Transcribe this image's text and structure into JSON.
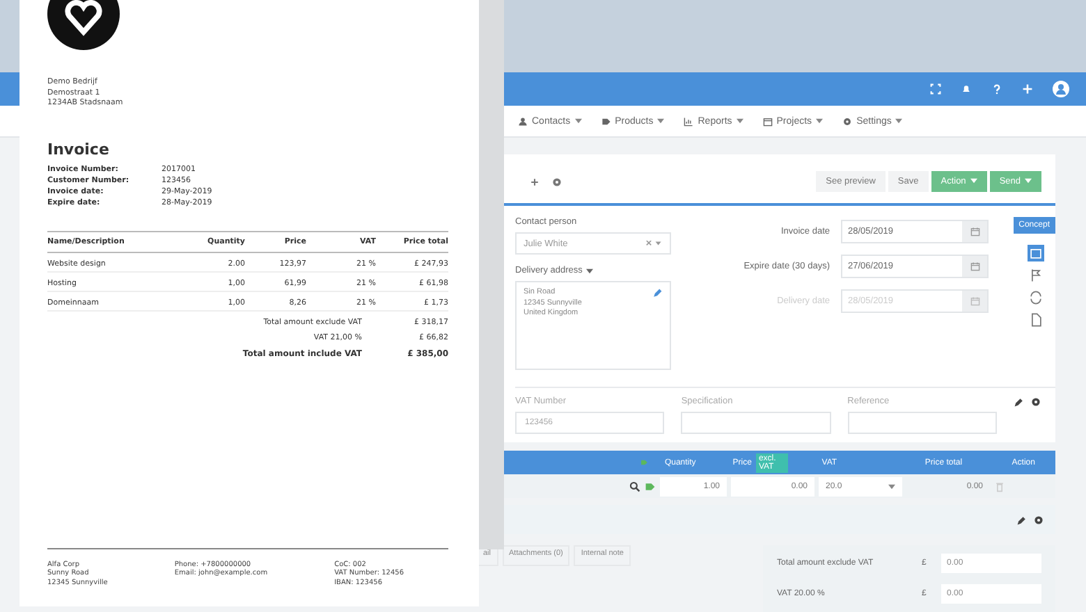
{
  "document": {
    "sender_address": [
      "Demo Bedrijf",
      "Demostraat 1",
      "1234AB Stadsnaam"
    ],
    "title": "Invoice",
    "meta": [
      {
        "label": "Invoice Number:",
        "value": "2017001"
      },
      {
        "label": "Customer Number:",
        "value": "123456"
      },
      {
        "label": "Invoice date:",
        "value": "29-May-2019"
      },
      {
        "label": "Expire date:",
        "value": "28-May-2019"
      }
    ],
    "columns": [
      "Name/Description",
      "Quantity",
      "Price",
      "VAT",
      "Price total"
    ],
    "rows": [
      {
        "name": "Website design",
        "quantity": "2.00",
        "price": "123,97",
        "vat": "21 %",
        "total": "£ 247,93"
      },
      {
        "name": "Hosting",
        "quantity": "1,00",
        "price": "61,99",
        "vat": "21 %",
        "total": "£ 61,98"
      },
      {
        "name": "Domeinnaam",
        "quantity": "1,00",
        "price": "8,26",
        "vat": "21 %",
        "total": "£ 1,73"
      }
    ],
    "totals": [
      {
        "label": "Total amount exclude VAT",
        "value": "£ 318,17",
        "bold": false
      },
      {
        "label": "VAT 21,00 %",
        "value": "£ 66,82",
        "bold": false
      },
      {
        "label": "Total amount include VAT",
        "value": "£ 385,00",
        "bold": true
      }
    ],
    "footer": [
      [
        "Alfa Corp",
        "Sunny Road",
        "12345 Sunnyville"
      ],
      [
        "Phone: +7800000000",
        "Email: john@example.com"
      ],
      [
        "CoC: 002",
        "VAT Number: 12456",
        "IBAN: 123456"
      ]
    ]
  },
  "app": {
    "nav": [
      {
        "label": "Contacts"
      },
      {
        "label": "Products"
      },
      {
        "label": "Reports"
      },
      {
        "label": "Projects"
      },
      {
        "label": "Settings"
      }
    ],
    "toolbar": [
      {
        "label": "See preview",
        "kind": "plain"
      },
      {
        "label": "Save",
        "kind": "plain"
      },
      {
        "label": "Action",
        "kind": "green"
      },
      {
        "label": "Send",
        "kind": "green"
      }
    ],
    "contact_person": {
      "label": "Contact person",
      "value": "Julie White"
    },
    "delivery_address": {
      "label": "Delivery address",
      "lines": [
        "Sin Road",
        "12345 Sunnyville",
        "United Kingdom"
      ]
    },
    "dates": [
      {
        "label": "Invoice date",
        "value": "28/05/2019",
        "disabled": false
      },
      {
        "label": "Expire date (30 days)",
        "value": "27/06/2019",
        "disabled": false
      },
      {
        "label": "Delivery date",
        "value": "28/05/2019",
        "disabled": true
      }
    ],
    "status": "Concept",
    "fields": [
      {
        "label": "VAT Number",
        "value": "123456"
      },
      {
        "label": "Specification"
      },
      {
        "label": "Reference"
      }
    ],
    "lines": {
      "columns": [
        "Quantity",
        "Price",
        "VAT",
        "Price total",
        "Action"
      ],
      "price_badge": "excl. VAT",
      "row": {
        "quantity": "1.00",
        "price": "0.00",
        "vat": "20.0",
        "total": "0.00"
      }
    },
    "tabs": [
      {
        "label": "ail"
      },
      {
        "label": "Attachments (0)"
      },
      {
        "label": "Internal note"
      }
    ],
    "totals": [
      {
        "label": "Total amount exclude VAT",
        "currency": "£",
        "value": "0.00"
      },
      {
        "label": "VAT 20.00 %",
        "currency": "£",
        "value": "0.00"
      }
    ]
  }
}
